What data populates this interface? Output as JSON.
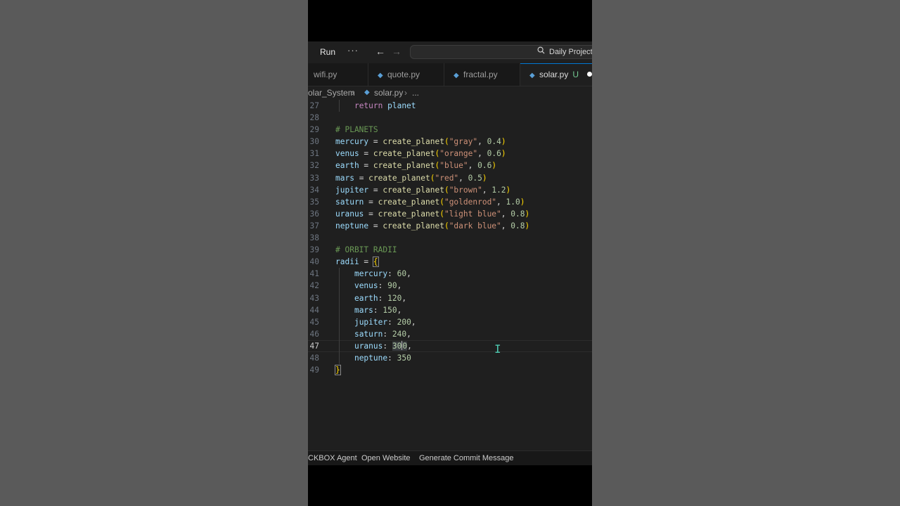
{
  "titlebar": {
    "run_label": "Run",
    "more_label": "···",
    "back_glyph": "←",
    "forward_glyph": "→",
    "search_label": "Daily Project",
    "icons": [
      "chevron-right-icon",
      "more-icon",
      "arrow-left-icon",
      "arrow-right-icon",
      "search-icon"
    ]
  },
  "tabs": [
    {
      "label": "wifi.py",
      "active": false
    },
    {
      "label": "quote.py",
      "active": false
    },
    {
      "label": "fractal.py",
      "active": false
    },
    {
      "label": "solar.py",
      "active": true,
      "status": "U"
    }
  ],
  "breadcrumb": {
    "folder": "olar_System",
    "file": "solar.py",
    "more": "..."
  },
  "editor": {
    "current_line": 47,
    "line_numbers": [
      "27",
      "28",
      "29",
      "30",
      "31",
      "32",
      "33",
      "34",
      "35",
      "36",
      "37",
      "38",
      "39",
      "40",
      "41",
      "42",
      "43",
      "44",
      "45",
      "46",
      "47",
      "48",
      "49"
    ],
    "lines": {
      "l27": {
        "kw": "return",
        "rest": " planet"
      },
      "l29": "# PLANETS",
      "l30": {
        "var": "mercury",
        "fn": "create_planet",
        "str": "\"gray\"",
        "num": "0.4"
      },
      "l31": {
        "var": "venus",
        "fn": "create_planet",
        "str": "\"orange\"",
        "num": "0.6"
      },
      "l32": {
        "var": "earth",
        "fn": "create_planet",
        "str": "\"blue\"",
        "num": "0.6"
      },
      "l33": {
        "var": "mars",
        "fn": "create_planet",
        "str": "\"red\"",
        "num": "0.5"
      },
      "l34": {
        "var": "jupiter",
        "fn": "create_planet",
        "str": "\"brown\"",
        "num": "1.2"
      },
      "l35": {
        "var": "saturn",
        "fn": "create_planet",
        "str": "\"goldenrod\"",
        "num": "1.0"
      },
      "l36": {
        "var": "uranus",
        "fn": "create_planet",
        "str": "\"light blue\"",
        "num": "0.8"
      },
      "l37": {
        "var": "neptune",
        "fn": "create_planet",
        "str": "\"dark blue\"",
        "num": "0.8"
      },
      "l39": "# ORBIT RADII",
      "l40": {
        "var": "radii"
      },
      "l41": {
        "key": "mercury",
        "num": "60"
      },
      "l42": {
        "key": "venus",
        "num": "90"
      },
      "l43": {
        "key": "earth",
        "num": "120"
      },
      "l44": {
        "key": "mars",
        "num": "150"
      },
      "l45": {
        "key": "jupiter",
        "num": "200"
      },
      "l46": {
        "key": "saturn",
        "num": "240"
      },
      "l47": {
        "key": "uranus",
        "num_a": "30",
        "num_b": "0"
      },
      "l48": {
        "key": "neptune",
        "num": "350"
      }
    }
  },
  "statusbar": {
    "agent": "CKBOX Agent",
    "open_website": "Open Website",
    "commit": "Generate Commit Message"
  },
  "colors": {
    "editor_bg": "#1f1f1f",
    "keyword": "#c586c0",
    "function": "#dcdcaa",
    "string": "#ce9178",
    "number": "#b5cea8",
    "comment": "#6a9955",
    "variable": "#9cdcfe",
    "bracket": "#ffd700",
    "accent": "#0078d4"
  }
}
